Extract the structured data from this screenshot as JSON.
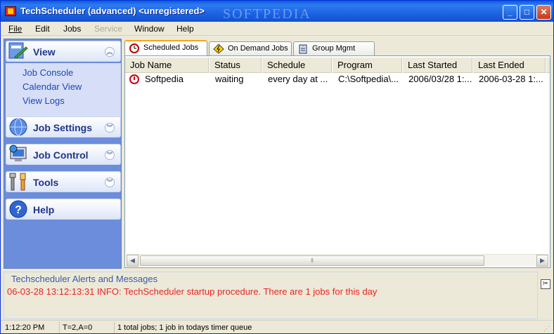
{
  "window": {
    "title": "TechScheduler (advanced)  <unregistered>",
    "watermark": "SOFTPEDIA",
    "watermark_url": "www.softpedia.com"
  },
  "menu": [
    {
      "label": "File",
      "enabled": true
    },
    {
      "label": "Edit",
      "enabled": true
    },
    {
      "label": "Jobs",
      "enabled": true
    },
    {
      "label": "Service",
      "enabled": false
    },
    {
      "label": "Window",
      "enabled": true
    },
    {
      "label": "Help",
      "enabled": true
    }
  ],
  "sidebar": {
    "groups": [
      {
        "label": "View",
        "icon": "view-icon",
        "expanded": true,
        "items": [
          "Job Console",
          "Calendar View",
          "View Logs"
        ]
      },
      {
        "label": "Job Settings",
        "icon": "globe-icon",
        "expanded": false
      },
      {
        "label": "Job Control",
        "icon": "computer-icon",
        "expanded": false
      },
      {
        "label": "Tools",
        "icon": "tools-icon",
        "expanded": false
      },
      {
        "label": "Help",
        "icon": "help-icon",
        "expanded": false
      }
    ]
  },
  "tabs": [
    {
      "label": "Scheduled Jobs",
      "icon": "clock-icon",
      "active": true
    },
    {
      "label": "On Demand Jobs",
      "icon": "lightning-icon",
      "active": false
    },
    {
      "label": "Group Mgmt",
      "icon": "clipboard-icon",
      "active": false
    }
  ],
  "grid": {
    "columns": [
      "Job Name",
      "Status",
      "Schedule",
      "Program",
      "Last Started",
      "Last Ended"
    ],
    "rows": [
      [
        "Softpedia",
        "waiting",
        "every day at ...",
        "C:\\Softpedia\\...",
        "2006/03/28 1:...",
        "2006-03-28 1:..."
      ]
    ]
  },
  "alerts": {
    "title": "Techscheduler Alerts and Messages",
    "message": "06-03-28 13:12:13:31  INFO: TechScheduler startup procedure. There are 1 jobs for this day"
  },
  "status": {
    "time": "1:12:20 PM",
    "counters": "T=2,A=0",
    "summary": "1 total jobs; 1 job in todays timer queue"
  },
  "colors": {
    "titlebar": "#1b64e3",
    "sidebar_bg": "#6b8ddb",
    "alert_text": "#ee2222",
    "link": "#1f47b8"
  }
}
